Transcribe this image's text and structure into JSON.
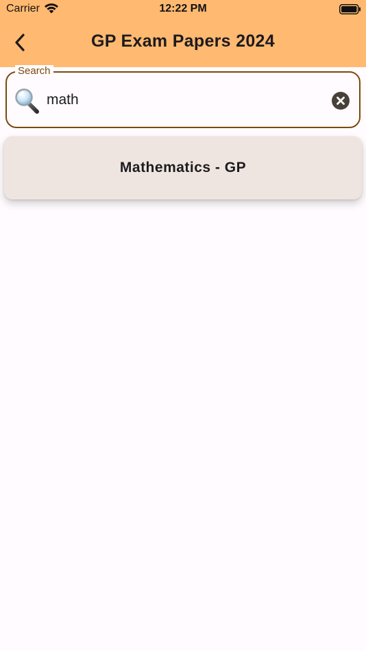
{
  "status_bar": {
    "carrier": "Carrier",
    "time": "12:22 PM"
  },
  "app_bar": {
    "title": "GP Exam Papers 2024",
    "background": "#ffb970"
  },
  "search": {
    "label": "Search",
    "value": "math",
    "border_color": "#7a4a0c"
  },
  "results": [
    {
      "label": "Mathematics - GP"
    }
  ],
  "icons": {
    "back": "chevron-left-icon",
    "search": "magnifying-glass-icon",
    "clear": "clear-circle-icon",
    "wifi": "wifi-icon",
    "battery": "battery-icon"
  }
}
